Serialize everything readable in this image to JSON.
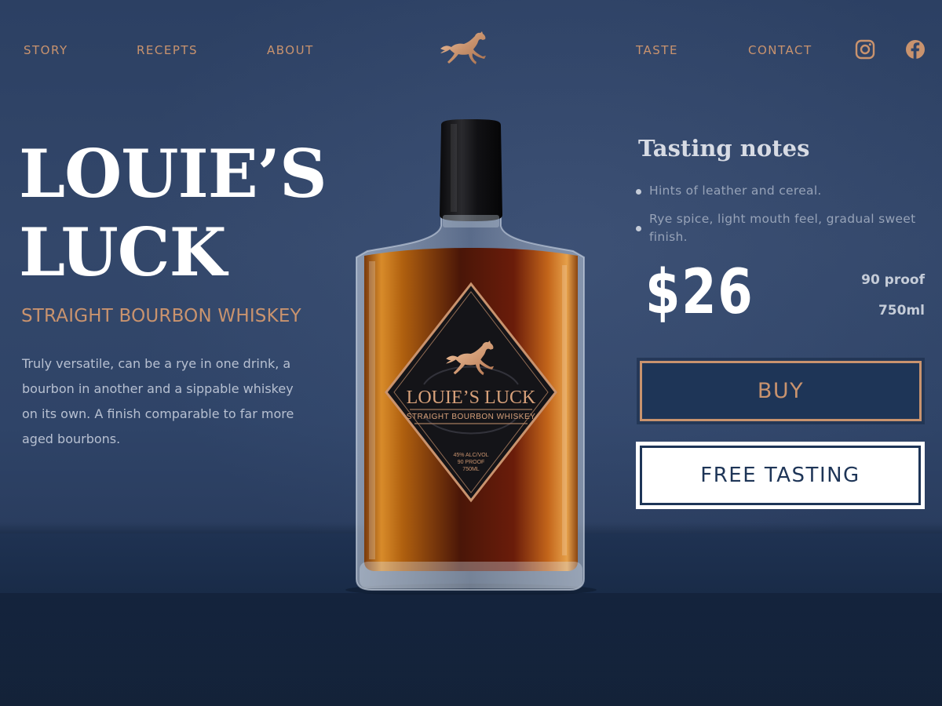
{
  "nav": {
    "story": "STORY",
    "recepts": "RECEPTS",
    "about": "ABOUT",
    "taste": "TASTE",
    "contact": "CONTACT"
  },
  "icons": {
    "logo": "horse-logo-icon",
    "instagram": "instagram-icon",
    "facebook": "facebook-icon"
  },
  "hero": {
    "title_line1": "LOUIE’S",
    "title_line2": "LUCK",
    "subtitle": "STRAIGHT BOURBON WHISKEY",
    "description": "Truly versatile, can be a rye in one drink, a bourbon in another and a sippable whiskey on its own. A finish comparable to far more aged bourbons."
  },
  "label": {
    "brand": "LOUIE’S LUCK",
    "type": "STRAIGHT BOURBON WHISKEY",
    "abv": "45% ALC/VOL",
    "proof": "90 PROOF",
    "volume": "750ML"
  },
  "tasting": {
    "title": "Tasting notes",
    "notes": [
      "Hints of leather and cereal.",
      "Rye spice, light mouth feel, gradual sweet finish."
    ]
  },
  "product": {
    "price": "$26",
    "proof": "90 proof",
    "volume": "750ml"
  },
  "actions": {
    "buy": "BUY",
    "free_tasting": "FREE TASTING"
  },
  "colors": {
    "background": "#2f4468",
    "accent": "#c9936e",
    "navy": "#1e3557",
    "white": "#ffffff"
  }
}
